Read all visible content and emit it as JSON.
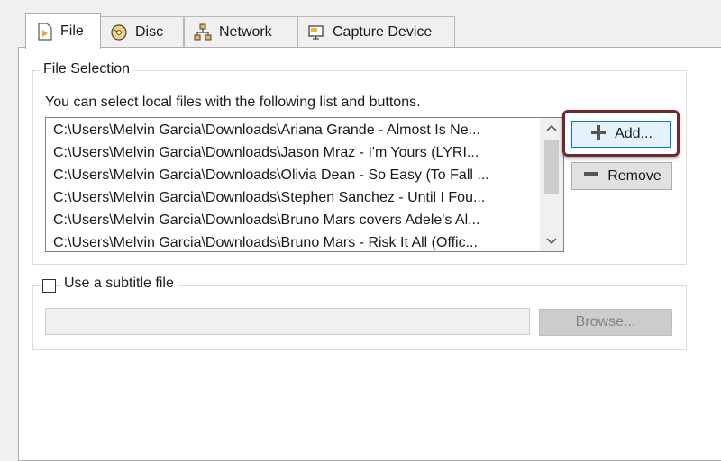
{
  "tabs": [
    {
      "label": "File",
      "icon": "file-play-icon",
      "active": true
    },
    {
      "label": "Disc",
      "icon": "disc-icon",
      "active": false
    },
    {
      "label": "Network",
      "icon": "network-icon",
      "active": false
    },
    {
      "label": "Capture Device",
      "icon": "capture-device-icon",
      "active": false
    }
  ],
  "file_selection": {
    "title": "File Selection",
    "description": "You can select local files with the following list and buttons.",
    "files": [
      "C:\\Users\\Melvin Garcia\\Downloads\\Ariana Grande - Almost Is Ne...",
      "C:\\Users\\Melvin Garcia\\Downloads\\Jason Mraz - I'm Yours (LYRI...",
      "C:\\Users\\Melvin Garcia\\Downloads\\Olivia Dean - So Easy (To Fall ...",
      "C:\\Users\\Melvin Garcia\\Downloads\\Stephen Sanchez - Until I Fou...",
      "C:\\Users\\Melvin Garcia\\Downloads\\Bruno Mars covers Adele's Al...",
      "C:\\Users\\Melvin Garcia\\Downloads\\Bruno Mars - Risk It All (Offic..."
    ],
    "add_label": "Add...",
    "remove_label": "Remove"
  },
  "subtitle": {
    "checkbox_label": "Use a subtitle file",
    "checked": false,
    "path_value": "",
    "browse_label": "Browse..."
  },
  "colors": {
    "highlight_border": "#6b2c31",
    "focus_border": "#0078d7",
    "window_bg": "#f0f0f0",
    "panel_bg": "#ffffff"
  }
}
